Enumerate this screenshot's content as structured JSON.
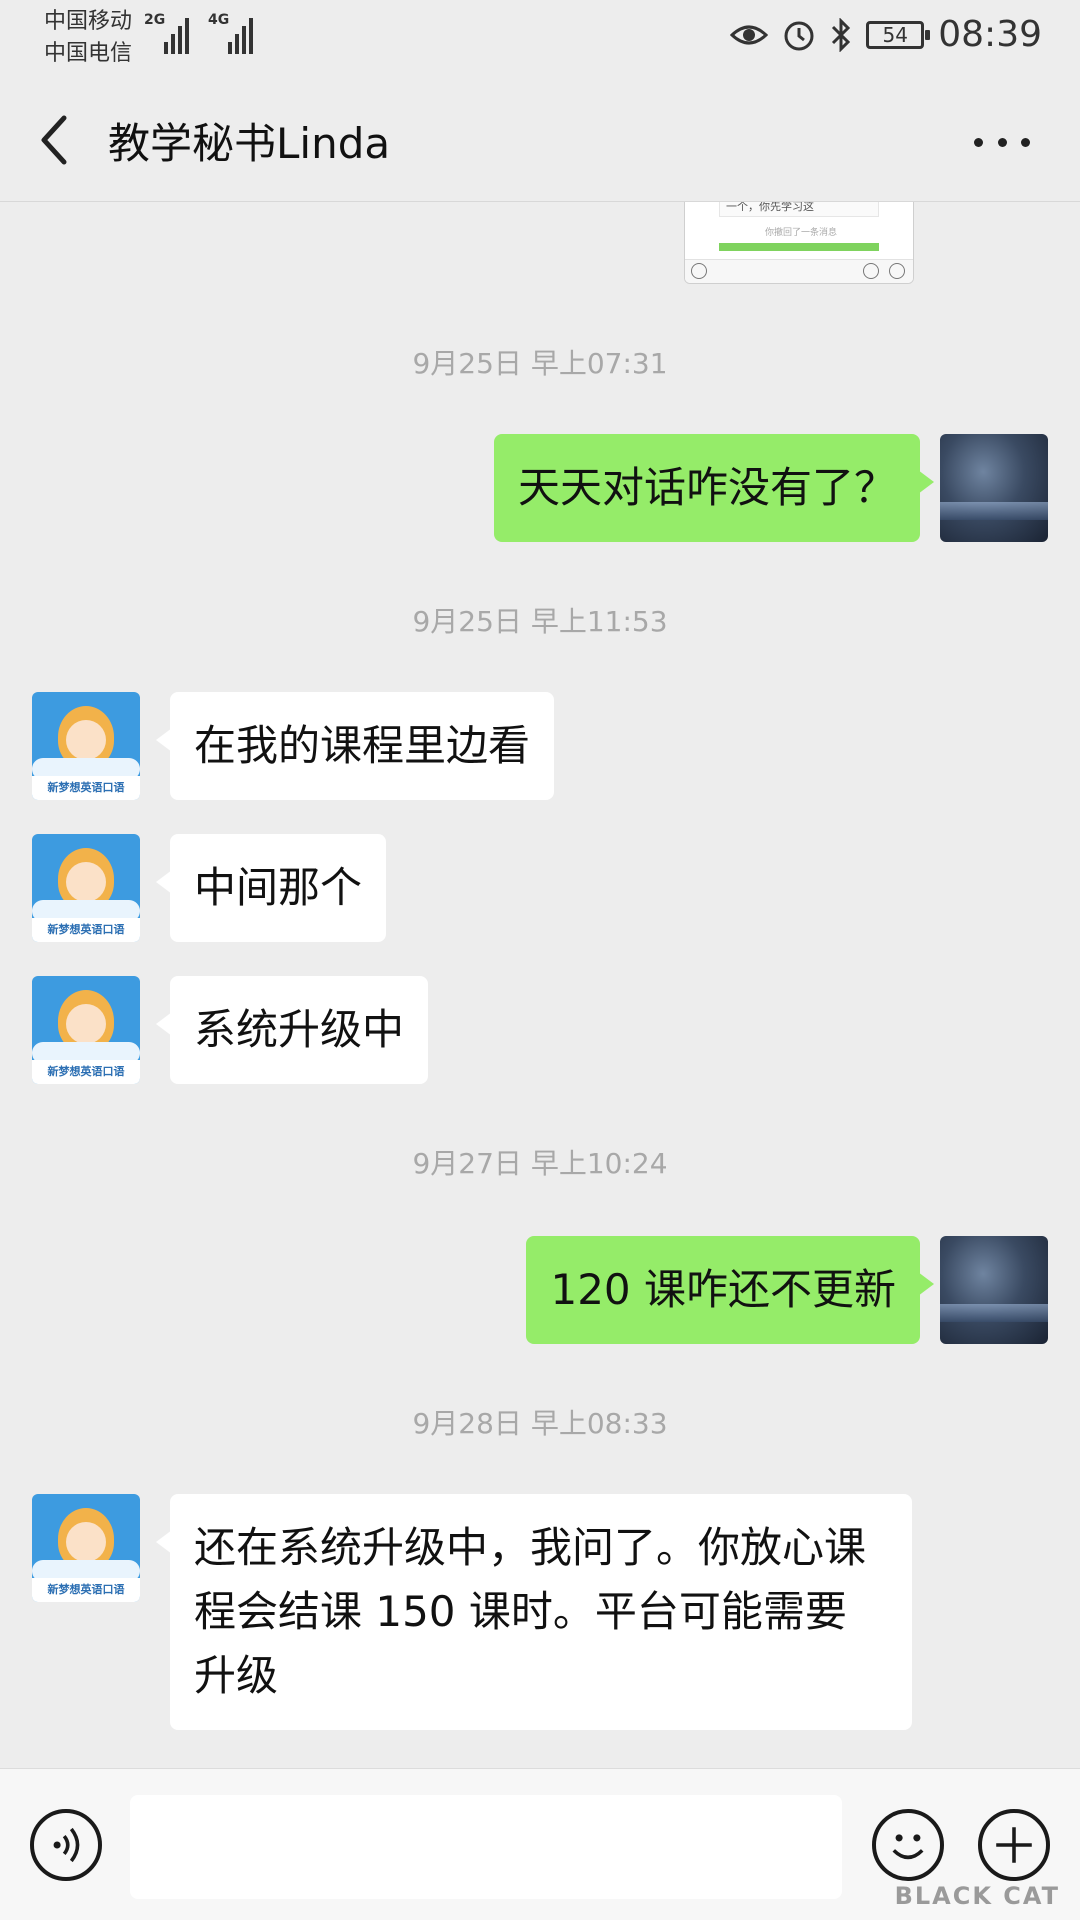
{
  "status_bar": {
    "carrier_1": "中国移动",
    "carrier_2": "中国电信",
    "sig1_label": "2G",
    "sig2_label": "4G",
    "battery": "54",
    "time": "08:39"
  },
  "header": {
    "title": "教学秘书Linda"
  },
  "messages": [
    {
      "type": "time",
      "text": "9月25日 早上07:31"
    },
    {
      "type": "out",
      "text": "天天对话咋没有了？"
    },
    {
      "type": "time",
      "text": "9月25日 早上11:53"
    },
    {
      "type": "in",
      "text": "在我的课程里边看"
    },
    {
      "type": "in",
      "text": "中间那个"
    },
    {
      "type": "in",
      "text": "系统升级中"
    },
    {
      "type": "time",
      "text": "9月27日 早上10:24"
    },
    {
      "type": "out",
      "text": "120 课咋还不更新"
    },
    {
      "type": "time",
      "text": "9月28日 早上08:33"
    },
    {
      "type": "in",
      "text": "还在系统升级中，我问了。你放心课程会结课 150 课时。平台可能需要升级"
    }
  ],
  "image_thumb": {
    "line1": "一个，你先学习这",
    "line2": "你撤回了一条消息"
  },
  "avatar_badge": "新梦想英语口语",
  "watermark": "BLACK CAT",
  "icons": [
    "back-arrow-icon",
    "more-dots-icon",
    "voice-icon",
    "emoji-icon",
    "plus-icon",
    "eye-icon",
    "alarm-icon",
    "bluetooth-icon",
    "battery-icon"
  ],
  "colors": {
    "background": "#ededed",
    "outgoing_bubble": "#95ec69",
    "incoming_bubble": "#ffffff",
    "timestamp": "#a8a8a8"
  }
}
